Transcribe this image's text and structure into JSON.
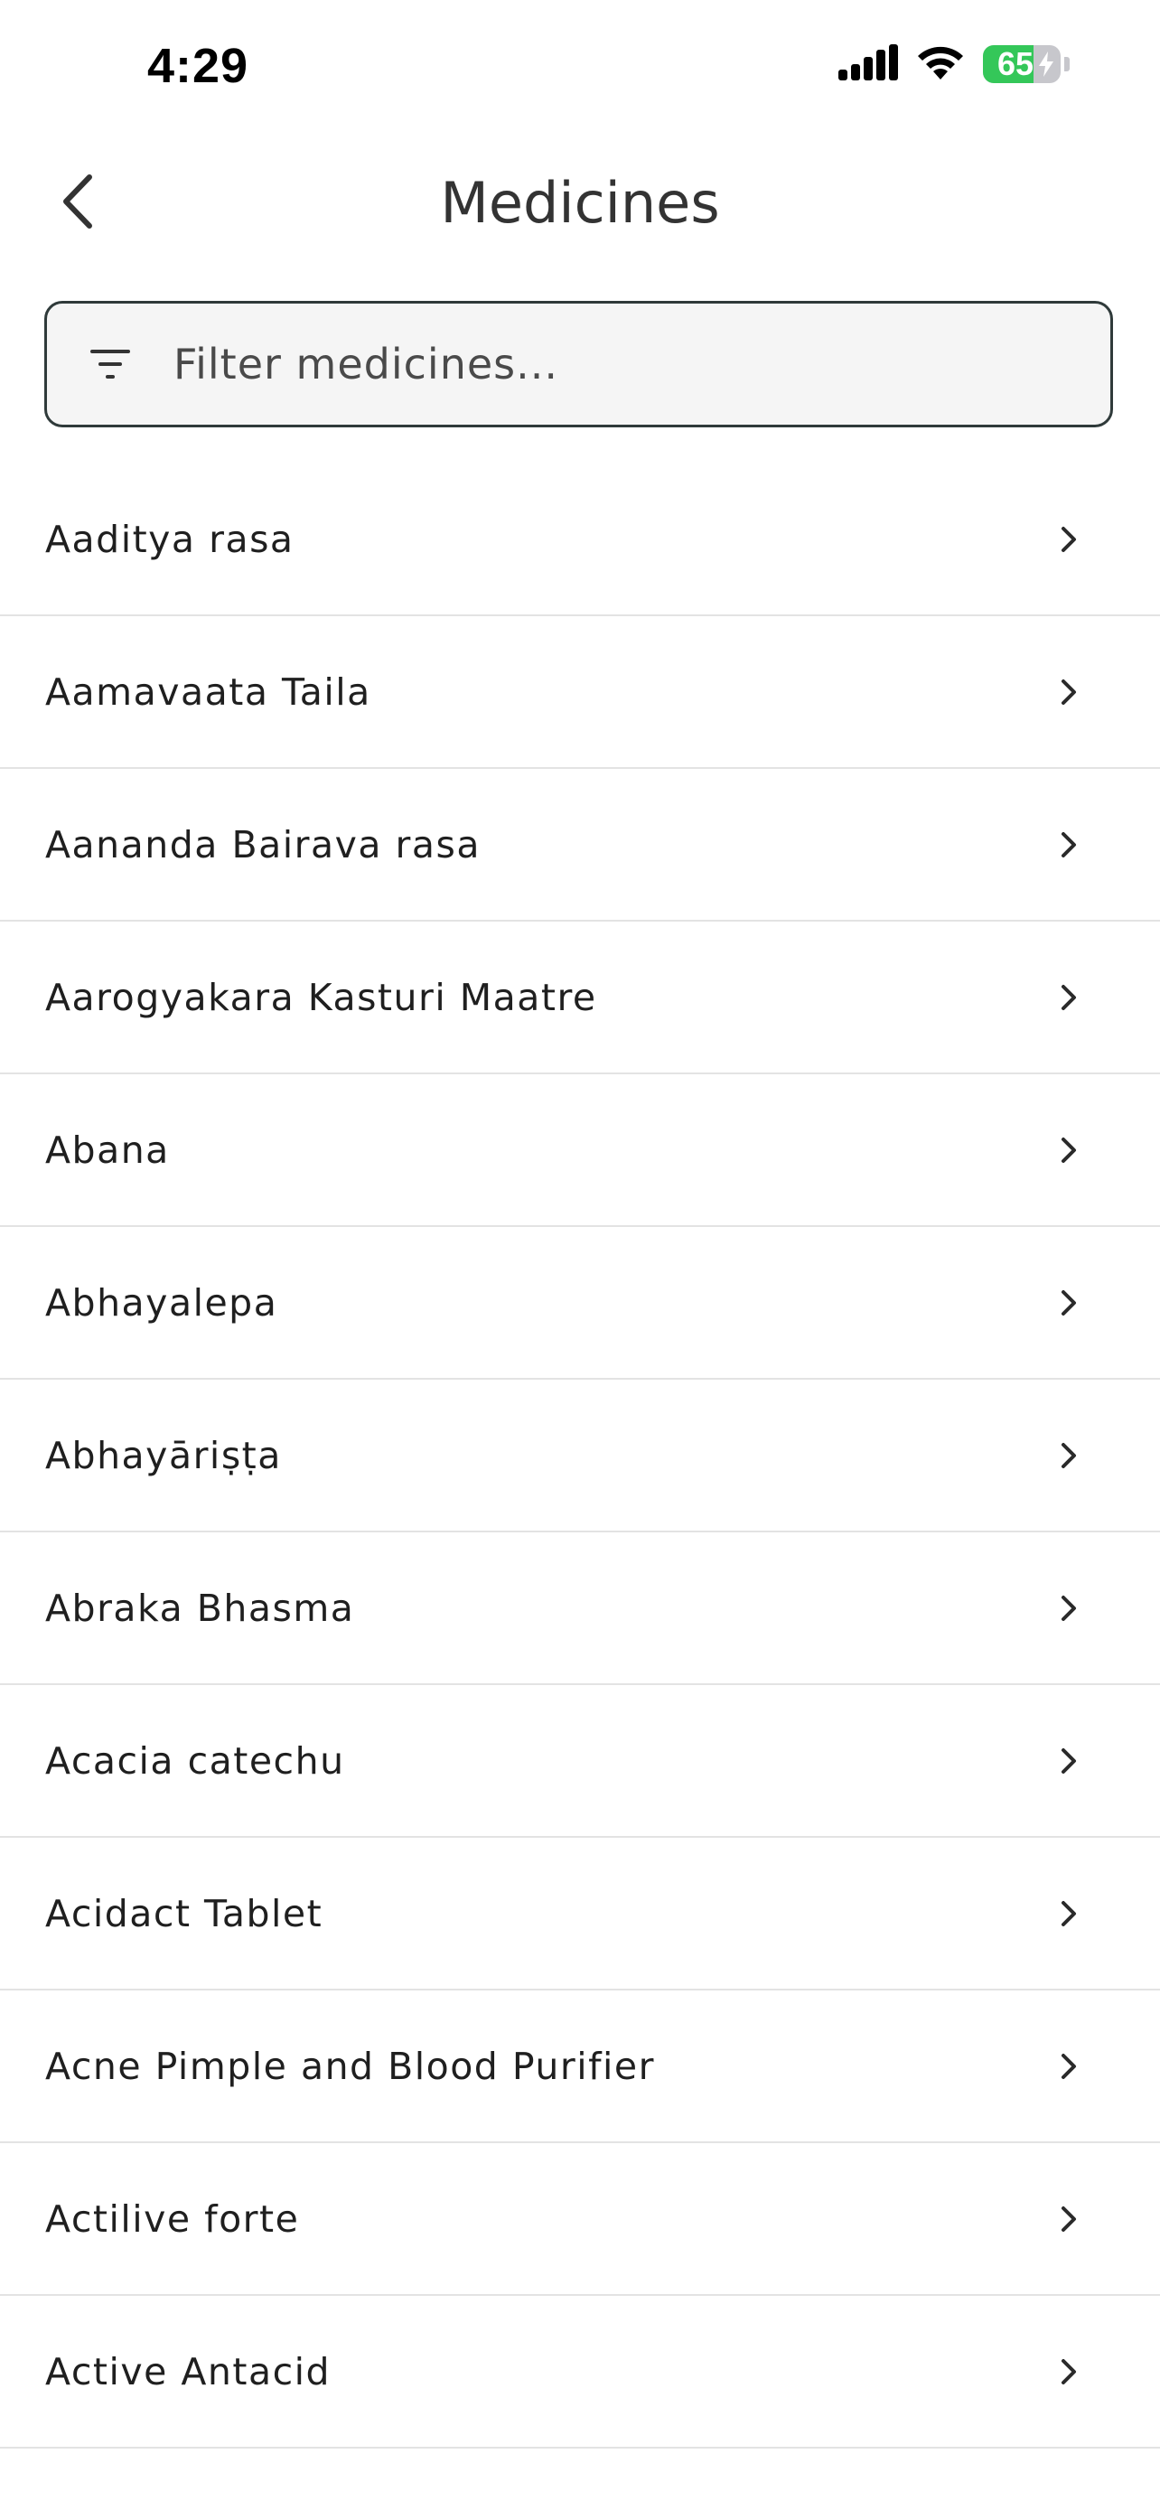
{
  "status_bar": {
    "time": "4:29",
    "battery_level": "65",
    "battery_fraction": 0.65,
    "charging": true
  },
  "header": {
    "title": "Medicines",
    "back_icon": "chevron-left-icon"
  },
  "filter": {
    "placeholder": "Filter medicines...",
    "value": "",
    "icon": "filter-icon"
  },
  "medicines": [
    {
      "label": "Aaditya rasa"
    },
    {
      "label": "Aamavaata Taila"
    },
    {
      "label": "Aananda Bairava rasa"
    },
    {
      "label": "Aarogyakara Kasturi Maatre"
    },
    {
      "label": "Abana"
    },
    {
      "label": "Abhayalepa"
    },
    {
      "label": "Abhayāriṣṭa"
    },
    {
      "label": "Abraka Bhasma"
    },
    {
      "label": "Acacia catechu"
    },
    {
      "label": "Acidact Tablet"
    },
    {
      "label": "Acne Pimple and Blood Purifier"
    },
    {
      "label": "Actilive forte"
    },
    {
      "label": "Active Antacid"
    }
  ],
  "colors": {
    "accent_battery": "#34c759",
    "filter_border": "#2f3a3a",
    "divider": "#e3e3e3"
  }
}
